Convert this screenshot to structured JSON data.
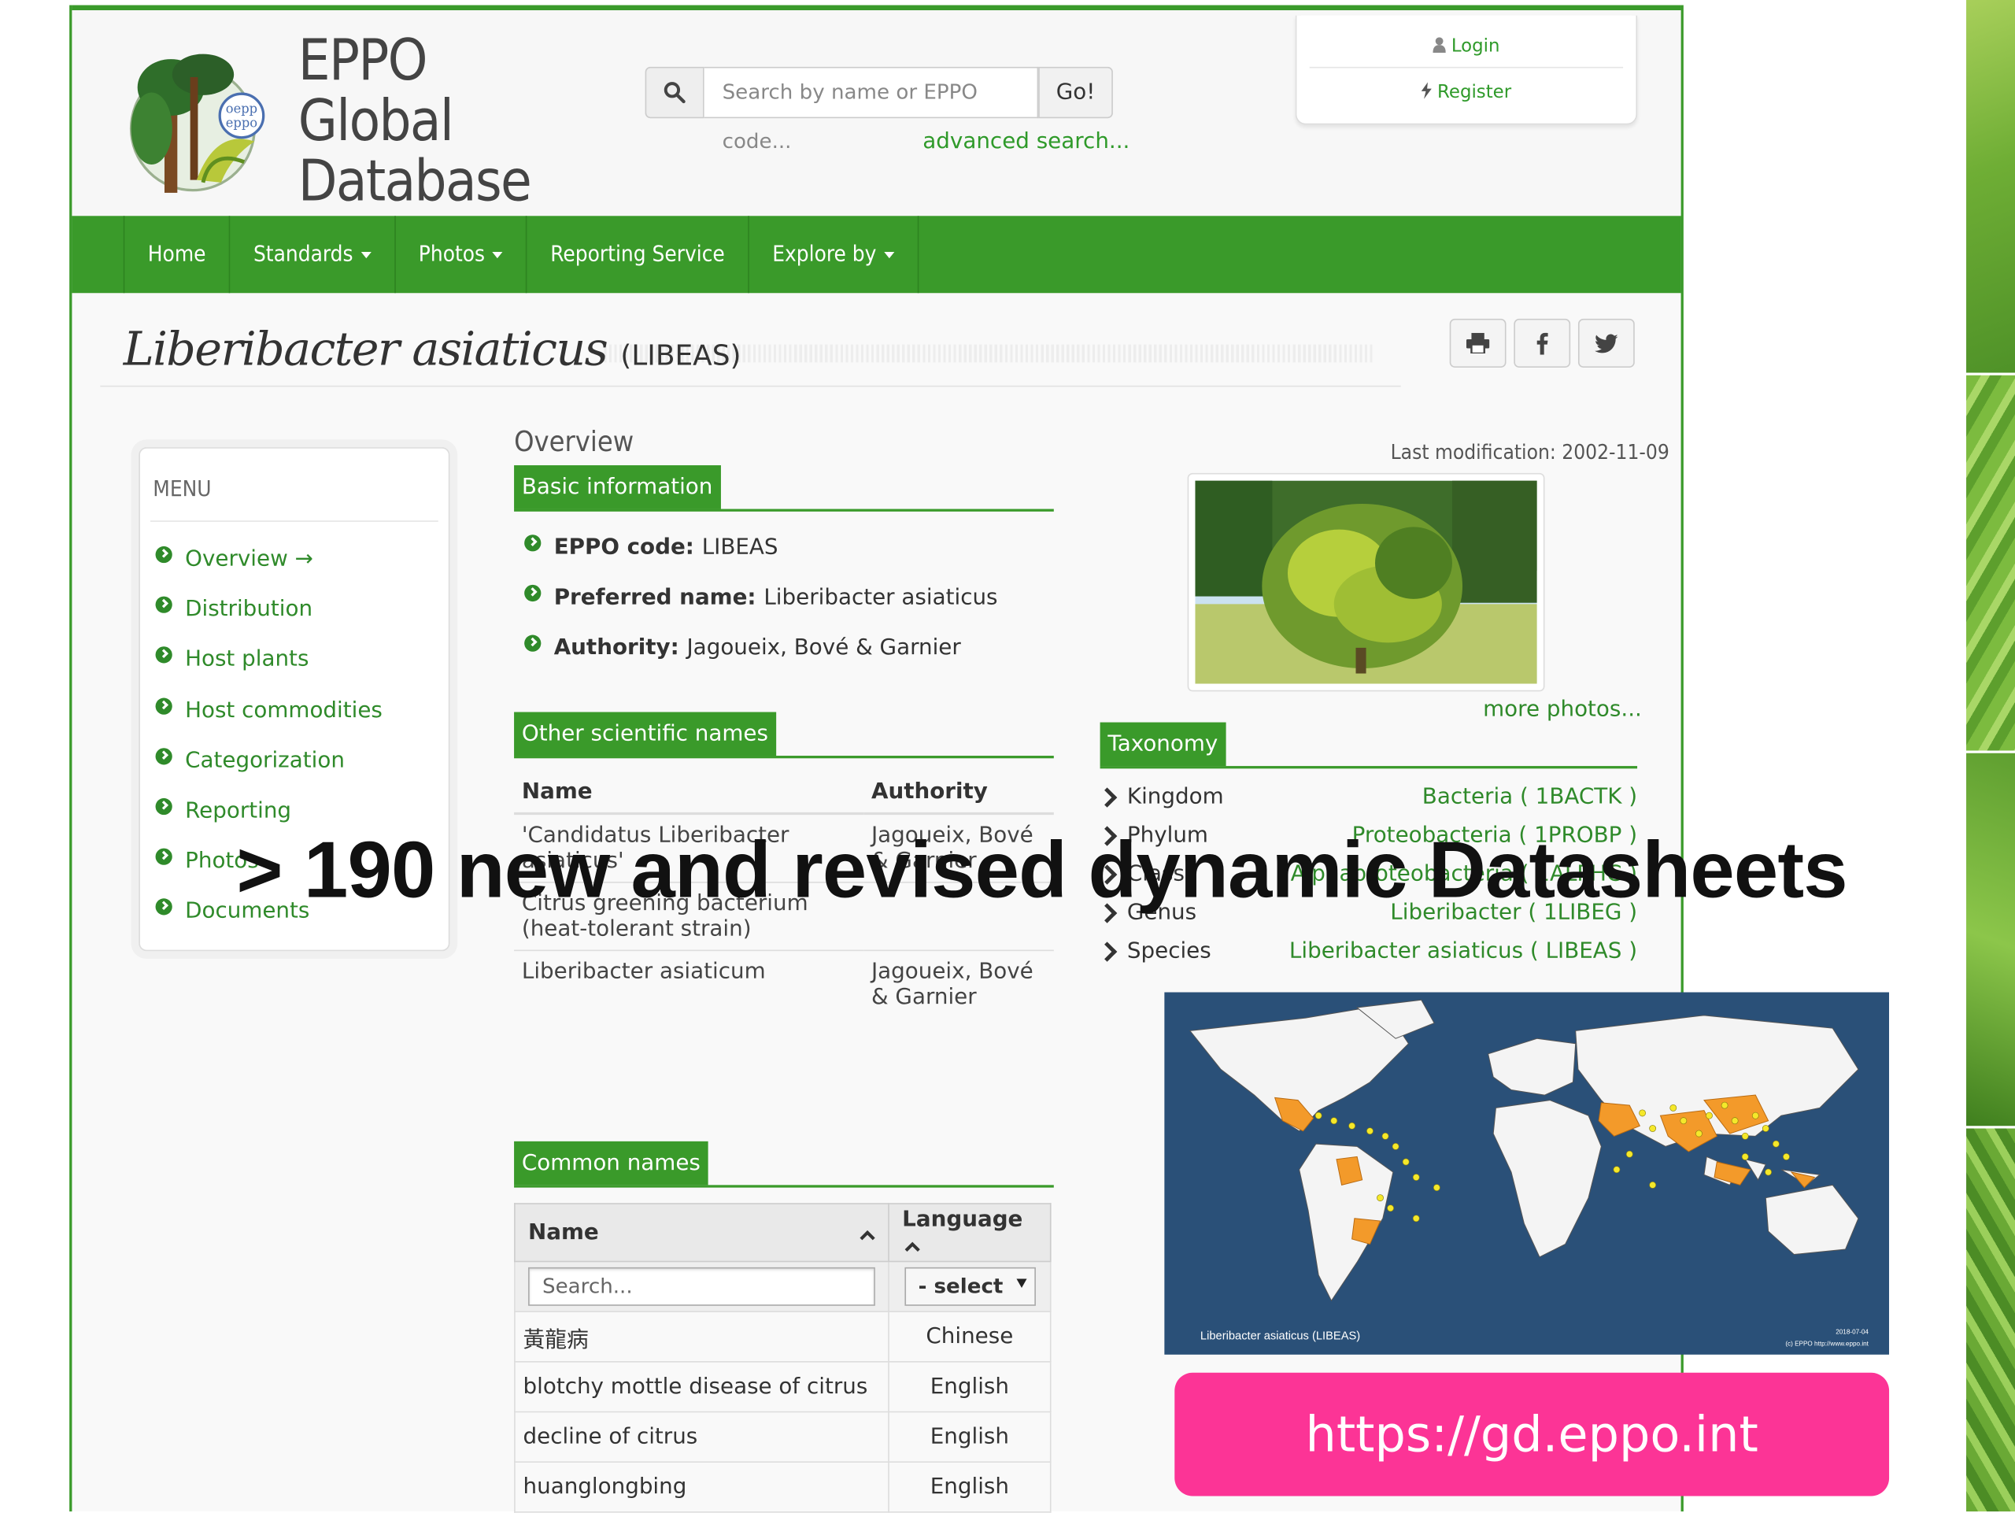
{
  "header": {
    "brand_line1": "EPPO",
    "brand_line2": "Global",
    "brand_line3": "Database",
    "search_placeholder": "Search by name or EPPO code...",
    "go_label": "Go!",
    "advanced_search": "advanced search...",
    "login": "Login",
    "register": "Register"
  },
  "nav": {
    "home": "Home",
    "standards": "Standards",
    "photos": "Photos",
    "reporting": "Reporting Service",
    "explore": "Explore by"
  },
  "page": {
    "title": "Liberibacter asiaticus",
    "code": "(LIBEAS)"
  },
  "menu": {
    "title": "MENU",
    "items": [
      "Overview →",
      "Distribution",
      "Host plants",
      "Host commodities",
      "Categorization",
      "Reporting",
      "Photos",
      "Documents"
    ]
  },
  "overview": {
    "heading": "Overview",
    "basic_info_label": "Basic information",
    "eppo_code_label": "EPPO code:",
    "eppo_code": "LIBEAS",
    "preferred_label": "Preferred name:",
    "preferred": "Liberibacter asiaticus",
    "authority_label": "Authority:",
    "authority": "Jagoueix, Bové & Garnier",
    "last_modification": "Last modification: 2002-11-09",
    "more_photos": "more photos..."
  },
  "other_names": {
    "label": "Other scientific names",
    "col_name": "Name",
    "col_authority": "Authority",
    "rows": [
      {
        "name": "'Candidatus Liberibacter asiaticus'",
        "authority": "Jagoueix, Bové & Garnier"
      },
      {
        "name": "Citrus greening bacterium (heat-tolerant strain)",
        "authority": ""
      },
      {
        "name": "Liberibacter asiaticum",
        "authority": "Jagoueix, Bové & Garnier"
      }
    ]
  },
  "common_names": {
    "label": "Common names",
    "col_name": "Name",
    "col_language": "Language",
    "search_placeholder": "Search...",
    "select_label": "- select",
    "rows": [
      {
        "name": "黃龍病",
        "language": "Chinese"
      },
      {
        "name": "blotchy mottle disease of citrus",
        "language": "English"
      },
      {
        "name": "decline of citrus",
        "language": "English"
      },
      {
        "name": "huanglongbing",
        "language": "English"
      }
    ]
  },
  "taxonomy": {
    "label": "Taxonomy",
    "rows": [
      {
        "rank": "Kingdom",
        "value": "Bacteria ( 1BACTK )"
      },
      {
        "rank": "Phylum",
        "value": "Proteobacteria ( 1PROBP )"
      },
      {
        "rank": "Class",
        "value": "Alphaproteobacteria ( 1ALPHC )"
      },
      {
        "rank": "Genus",
        "value": "Liberibacter ( 1LIBEG )"
      },
      {
        "rank": "Species",
        "value": "Liberibacter asiaticus ( LIBEAS )"
      }
    ]
  },
  "map": {
    "caption": "Liberibacter asiaticus (LIBEAS)",
    "credit": "(c) EPPO http://www.eppo.int",
    "date": "2018-07-04",
    "ocean_color": "#2a5078",
    "presence_color": "#f39a2a",
    "point_color": "#f5e82a"
  },
  "slide": {
    "overlay_text": "> 190 new and revised dynamic Datasheets",
    "url": "https://gd.eppo.int",
    "url_color": "#fc3496"
  },
  "colors": {
    "brand_green": "#3a9a2a",
    "link_green": "#2f8a2a"
  }
}
